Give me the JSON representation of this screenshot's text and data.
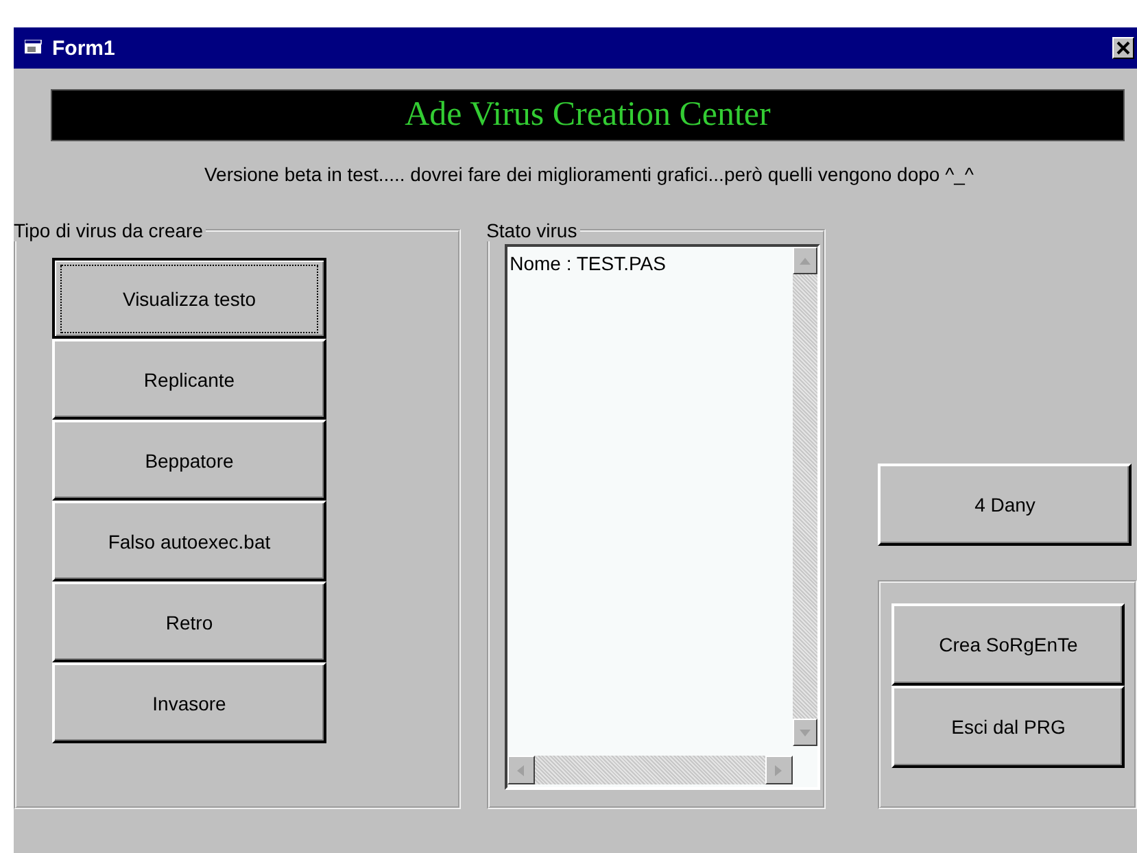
{
  "window": {
    "title": "Form1"
  },
  "banner": "Ade Virus Creation Center",
  "subtitle": "Versione beta in test..... dovrei fare dei miglioramenti grafici...però quelli vengono dopo ^_^",
  "virus_type_group": {
    "title": "Tipo di virus da creare",
    "buttons": [
      {
        "label": "Visualizza testo",
        "focused": true
      },
      {
        "label": "Replicante",
        "focused": false
      },
      {
        "label": "Beppatore",
        "focused": false
      },
      {
        "label": "Falso autoexec.bat",
        "focused": false
      },
      {
        "label": "Retro",
        "focused": false
      },
      {
        "label": "Invasore",
        "focused": false
      }
    ]
  },
  "status_group": {
    "title": "Stato virus",
    "text": "Nome : TEST.PAS"
  },
  "dedication_button": "4 Dany",
  "action_buttons": [
    "Crea SoRgEnTe",
    "Esci dal PRG"
  ]
}
